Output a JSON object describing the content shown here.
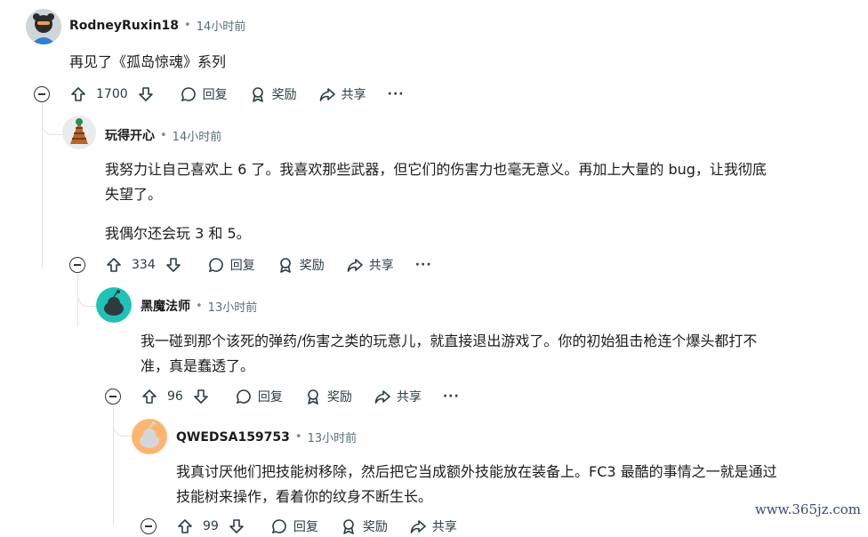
{
  "comments": [
    {
      "user": "RodneyRuxin18",
      "sep": "•",
      "time": "14小时前",
      "text": [
        "再见了《孤岛惊魂》系列"
      ],
      "votes": "1700"
    },
    {
      "user": "玩得开心",
      "sep": "•",
      "time": "14小时前",
      "text": [
        "我努力让自己喜欢上 6 了。我喜欢那些武器，但它们的伤害力也毫无意义。再加上大量的 bug，让我彻底",
        "失望了。",
        "我偶尔还会玩 3 和 5。"
      ],
      "votes": "334"
    },
    {
      "user": "黑魔法师",
      "sep": "•",
      "time": "13小时前",
      "text": [
        "我一碰到那个该死的弹药/伤害之类的玩意儿，就直接退出游戏了。你的初始狙击枪连个爆头都打不",
        "准，真是蠢透了。"
      ],
      "votes": "96"
    },
    {
      "user": "QWEDSA159753",
      "sep": "•",
      "time": "13小时前",
      "text": [
        "我真讨厌他们把技能树移除，然后把它当成额外技能放在装备上。FC3 最酷的事情之一就是通过",
        "技能树来操作，看着你的纹身不断生长。"
      ],
      "votes": "99"
    }
  ],
  "actions": {
    "reply": "回复",
    "award": "奖励",
    "share": "共享",
    "more": "···"
  },
  "watermark": "www.365jz.com",
  "colors": {
    "avatar_teal": "#1fc2b7",
    "avatar_orange": "#ffb470",
    "thread_line": "#dfe3e6"
  }
}
